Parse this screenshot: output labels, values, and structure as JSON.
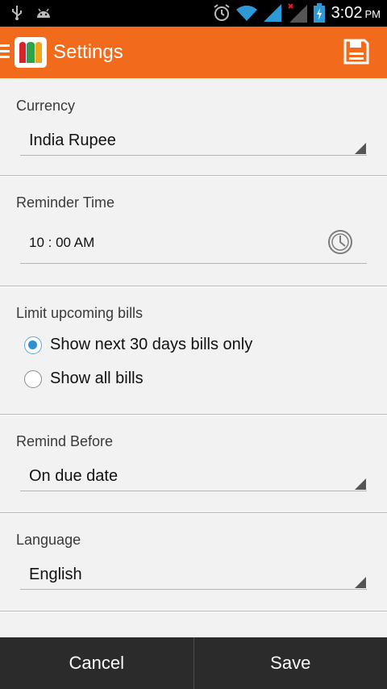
{
  "status_bar": {
    "time": "3:02",
    "ampm": "PM",
    "icons": [
      "usb-icon",
      "android-icon",
      "alarm-icon",
      "wifi-icon",
      "signal-icon",
      "signal-no-data-icon",
      "battery-charging-icon"
    ]
  },
  "action_bar": {
    "title": "Settings",
    "logo_letter": "m",
    "icons": [
      "menu-icon",
      "app-logo-icon",
      "save-icon"
    ]
  },
  "settings": {
    "currency": {
      "label": "Currency",
      "value": "India Rupee"
    },
    "reminder_time": {
      "label": "Reminder Time",
      "value": "10 : 00 AM"
    },
    "limit_bills": {
      "label": "Limit upcoming bills",
      "options": [
        {
          "label": "Show next 30 days bills only",
          "checked": true
        },
        {
          "label": "Show all bills",
          "checked": false
        }
      ]
    },
    "remind_before": {
      "label": "Remind Before",
      "value": "On due date"
    },
    "language": {
      "label": "Language",
      "value": "English"
    }
  },
  "bottom_bar": {
    "cancel_label": "Cancel",
    "save_label": "Save"
  },
  "colors": {
    "accent": "#f26a1b",
    "radio_checked": "#2f8fd0",
    "bottom_bar": "#2b2b2b"
  }
}
